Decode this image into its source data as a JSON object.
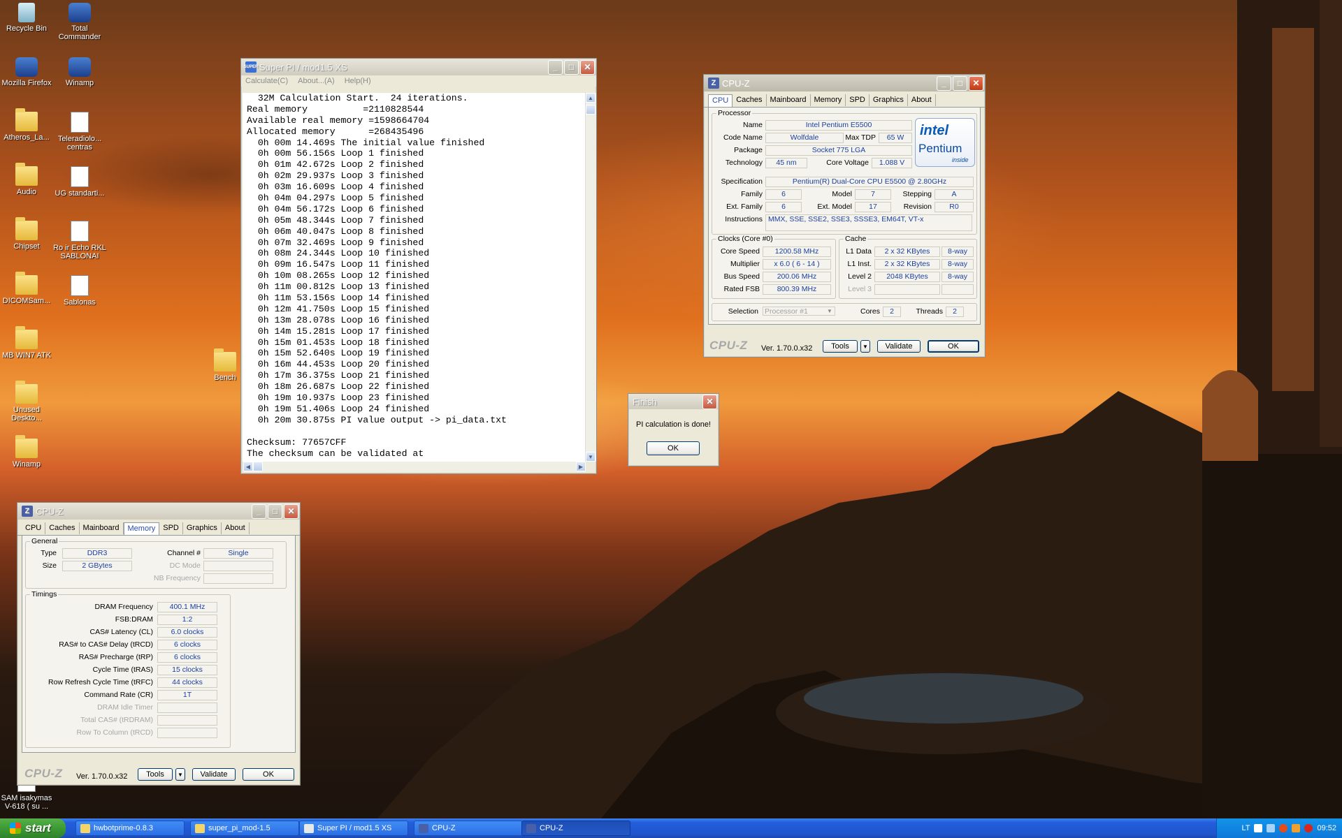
{
  "desktop": {
    "icons": [
      {
        "label": "Recycle Bin",
        "type": "bin"
      },
      {
        "label": "Total Commander",
        "type": "app"
      },
      {
        "label": "Mozilla Firefox",
        "type": "app"
      },
      {
        "label": "Winamp",
        "type": "app"
      },
      {
        "label": "Atheros_La...",
        "type": "folder"
      },
      {
        "label": "Teleradiolo... centras",
        "type": "file"
      },
      {
        "label": "Audio",
        "type": "folder"
      },
      {
        "label": "UG standarti...",
        "type": "file"
      },
      {
        "label": "Chipset",
        "type": "folder"
      },
      {
        "label": "Ro ir Echo RKL SABLONAI",
        "type": "file"
      },
      {
        "label": "DICOMSam...",
        "type": "folder"
      },
      {
        "label": "Sablonas",
        "type": "file"
      },
      {
        "label": "MB WIN7 ATK",
        "type": "folder"
      },
      {
        "label": "Bench",
        "type": "folder"
      },
      {
        "label": "Unused Deskto...",
        "type": "folder"
      },
      {
        "label": "Winamp",
        "type": "folder"
      },
      {
        "label": "SAM isakymas V-618 ( su ...",
        "type": "file"
      }
    ]
  },
  "superpi": {
    "title": "Super PI / mod1.5 XS",
    "icon_text": "SUPER",
    "menu": [
      "Calculate(C)",
      "About...(A)",
      "Help(H)"
    ],
    "lines": [
      "  32M Calculation Start.  24 iterations.",
      "Real memory          =2110828544",
      "Available real memory =1598664704",
      "Allocated memory      =268435496",
      "  0h 00m 14.469s The initial value finished",
      "  0h 00m 56.156s Loop 1 finished",
      "  0h 01m 42.672s Loop 2 finished",
      "  0h 02m 29.937s Loop 3 finished",
      "  0h 03m 16.609s Loop 4 finished",
      "  0h 04m 04.297s Loop 5 finished",
      "  0h 04m 56.172s Loop 6 finished",
      "  0h 05m 48.344s Loop 7 finished",
      "  0h 06m 40.047s Loop 8 finished",
      "  0h 07m 32.469s Loop 9 finished",
      "  0h 08m 24.344s Loop 10 finished",
      "  0h 09m 16.547s Loop 11 finished",
      "  0h 10m 08.265s Loop 12 finished",
      "  0h 11m 00.812s Loop 13 finished",
      "  0h 11m 53.156s Loop 14 finished",
      "  0h 12m 41.750s Loop 15 finished",
      "  0h 13m 28.078s Loop 16 finished",
      "  0h 14m 15.281s Loop 17 finished",
      "  0h 15m 01.453s Loop 18 finished",
      "  0h 15m 52.640s Loop 19 finished",
      "  0h 16m 44.453s Loop 20 finished",
      "  0h 17m 36.375s Loop 21 finished",
      "  0h 18m 26.687s Loop 22 finished",
      "  0h 19m 10.937s Loop 23 finished",
      "  0h 19m 51.406s Loop 24 finished",
      "  0h 20m 30.875s PI value output -> pi_data.txt",
      "",
      "Checksum: 77657CFF",
      "The checksum can be validated at"
    ]
  },
  "finish": {
    "title": "Finish",
    "message": "PI calculation is done!",
    "ok": "OK"
  },
  "cpuz_main": {
    "title": "CPU-Z",
    "tabs": [
      "CPU",
      "Caches",
      "Mainboard",
      "Memory",
      "SPD",
      "Graphics",
      "About"
    ],
    "selected_tab": "CPU",
    "processor": {
      "legend": "Processor",
      "name_label": "Name",
      "name": "Intel Pentium E5500",
      "codename_label": "Code Name",
      "codename": "Wolfdale",
      "maxtdp_label": "Max TDP",
      "maxtdp": "65 W",
      "package_label": "Package",
      "package": "Socket 775 LGA",
      "technology_label": "Technology",
      "technology": "45 nm",
      "corevoltage_label": "Core Voltage",
      "corevoltage": "1.088 V",
      "spec_label": "Specification",
      "spec": "Pentium(R) Dual-Core  CPU    E5500  @ 2.80GHz",
      "family_label": "Family",
      "family": "6",
      "model_label": "Model",
      "model": "7",
      "stepping_label": "Stepping",
      "stepping": "A",
      "extfamily_label": "Ext. Family",
      "extfamily": "6",
      "extmodel_label": "Ext. Model",
      "extmodel": "17",
      "revision_label": "Revision",
      "revision": "R0",
      "instructions_label": "Instructions",
      "instructions": "MMX, SSE, SSE2, SSE3, SSSE3, EM64T, VT-x"
    },
    "logo": {
      "brand": "intel",
      "product": "Pentium",
      "sub": "inside"
    },
    "clocks": {
      "legend": "Clocks (Core #0)",
      "corespeed_label": "Core Speed",
      "corespeed": "1200.58 MHz",
      "multiplier_label": "Multiplier",
      "multiplier": "x 6.0 ( 6 - 14 )",
      "busspeed_label": "Bus Speed",
      "busspeed": "200.06 MHz",
      "ratedfsb_label": "Rated FSB",
      "ratedfsb": "800.39 MHz"
    },
    "cache": {
      "legend": "Cache",
      "l1d_label": "L1 Data",
      "l1d": "2 x 32 KBytes",
      "l1d_way": "8-way",
      "l1i_label": "L1 Inst.",
      "l1i": "2 x 32 KBytes",
      "l1i_way": "8-way",
      "l2_label": "Level 2",
      "l2": "2048 KBytes",
      "l2_way": "8-way",
      "l3_label": "Level 3"
    },
    "selection_label": "Selection",
    "selection": "Processor #1",
    "cores_label": "Cores",
    "cores": "2",
    "threads_label": "Threads",
    "threads": "2",
    "brand": "CPU-Z",
    "version": "Ver. 1.70.0.x32",
    "tools": "Tools",
    "validate": "Validate",
    "ok": "OK"
  },
  "cpuz_mem": {
    "title": "CPU-Z",
    "tabs": [
      "CPU",
      "Caches",
      "Mainboard",
      "Memory",
      "SPD",
      "Graphics",
      "About"
    ],
    "selected_tab": "Memory",
    "general": {
      "legend": "General",
      "type_label": "Type",
      "type": "DDR3",
      "channel_label": "Channel #",
      "channel": "Single",
      "size_label": "Size",
      "size": "2 GBytes",
      "dcmode_label": "DC Mode",
      "nbfreq_label": "NB Frequency"
    },
    "timings": {
      "legend": "Timings",
      "rows": [
        {
          "label": "DRAM Frequency",
          "value": "400.1 MHz",
          "gray": false
        },
        {
          "label": "FSB:DRAM",
          "value": "1:2",
          "gray": false
        },
        {
          "label": "CAS# Latency (CL)",
          "value": "6.0 clocks",
          "gray": false
        },
        {
          "label": "RAS# to CAS# Delay (tRCD)",
          "value": "6 clocks",
          "gray": false
        },
        {
          "label": "RAS# Precharge (tRP)",
          "value": "6 clocks",
          "gray": false
        },
        {
          "label": "Cycle Time (tRAS)",
          "value": "15 clocks",
          "gray": false
        },
        {
          "label": "Row Refresh Cycle Time (tRFC)",
          "value": "44 clocks",
          "gray": false
        },
        {
          "label": "Command Rate (CR)",
          "value": "1T",
          "gray": false
        },
        {
          "label": "DRAM Idle Timer",
          "value": "",
          "gray": true
        },
        {
          "label": "Total CAS# (tRDRAM)",
          "value": "",
          "gray": true
        },
        {
          "label": "Row To Column (tRCD)",
          "value": "",
          "gray": true
        }
      ]
    },
    "brand": "CPU-Z",
    "version": "Ver. 1.70.0.x32",
    "tools": "Tools",
    "validate": "Validate",
    "ok": "OK"
  },
  "taskbar": {
    "start": "start",
    "items": [
      {
        "label": "hwbotprime-0.8.3",
        "icon": "folder-icon",
        "active": false
      },
      {
        "label": "super_pi_mod-1.5",
        "icon": "folder-icon",
        "active": false
      },
      {
        "label": "Super PI / mod1.5 XS",
        "icon": "superpi-icon",
        "active": false
      },
      {
        "label": "CPU-Z",
        "icon": "cpuz-icon",
        "active": false
      },
      {
        "label": "CPU-Z",
        "icon": "cpuz-icon",
        "active": true
      }
    ],
    "lang": "LT",
    "clock": "09:52"
  }
}
